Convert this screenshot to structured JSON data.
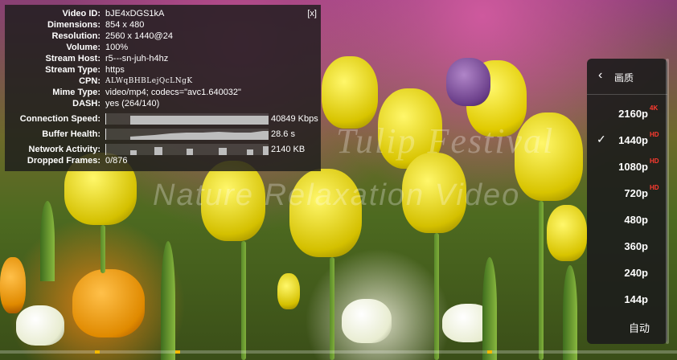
{
  "stats": {
    "close_label": "[x]",
    "rows": [
      {
        "key": "Video ID:",
        "value": "bJE4xDGS1kA"
      },
      {
        "key": "Dimensions:",
        "value": "854 x 480"
      },
      {
        "key": "Resolution:",
        "value": "2560 x 1440@24"
      },
      {
        "key": "Volume:",
        "value": "100%"
      },
      {
        "key": "Stream Host:",
        "value": "r5---sn-juh-h4hz"
      },
      {
        "key": "Stream Type:",
        "value": "https"
      },
      {
        "key": "CPN:",
        "value": "ALWqBHBLejQcLNgK"
      },
      {
        "key": "Mime Type:",
        "value": "video/mp4; codecs=\"avc1.640032\""
      },
      {
        "key": "DASH:",
        "value": "yes (264/140)"
      }
    ],
    "graphs": [
      {
        "key": "Connection Speed:",
        "value": "40849 Kbps"
      },
      {
        "key": "Buffer Health:",
        "value": "28.6 s"
      },
      {
        "key": "Network Activity:",
        "value": "2140 KB"
      }
    ],
    "dropped": {
      "key": "Dropped Frames:",
      "value": "0/876"
    }
  },
  "quality_menu": {
    "back_icon": "chevron-left-icon",
    "title": "画质",
    "items": [
      {
        "label": "2160p",
        "badge": "4K",
        "selected": false
      },
      {
        "label": "1440p",
        "badge": "HD",
        "selected": true
      },
      {
        "label": "1080p",
        "badge": "HD",
        "selected": false
      },
      {
        "label": "720p",
        "badge": "HD",
        "selected": false
      },
      {
        "label": "480p",
        "badge": "",
        "selected": false
      },
      {
        "label": "360p",
        "badge": "",
        "selected": false
      },
      {
        "label": "240p",
        "badge": "",
        "selected": false
      },
      {
        "label": "144p",
        "badge": "",
        "selected": false
      },
      {
        "label": "自动",
        "badge": "",
        "selected": false
      }
    ],
    "check_icon": "checkmark-icon"
  },
  "watermark": {
    "line1": "Tulip Festival",
    "line2": "Nature Relaxation Video"
  },
  "progress": {
    "played_fraction": 0.0
  }
}
